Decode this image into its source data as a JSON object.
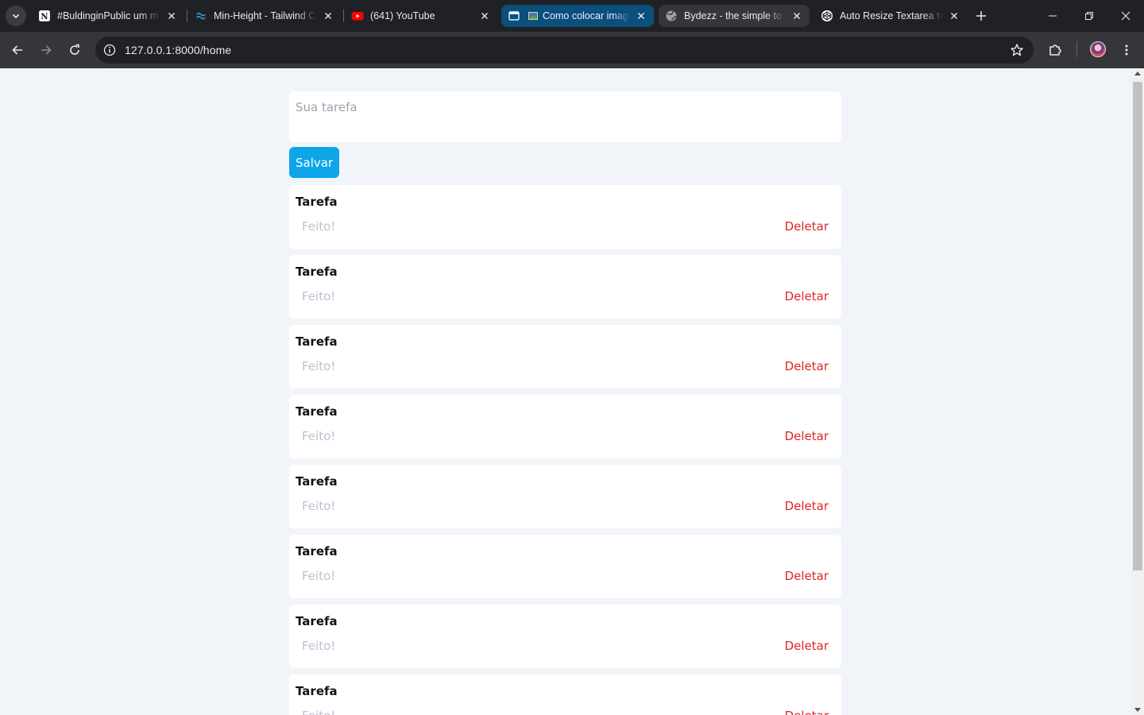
{
  "browser": {
    "tabs": [
      {
        "title": "#BuldinginPublic um m",
        "icon": "notion-icon"
      },
      {
        "title": "Min-Height - Tailwind C",
        "icon": "tailwind-icon"
      },
      {
        "title": "(641) YouTube",
        "icon": "youtube-icon"
      },
      {
        "title": "Como colocar imag",
        "icon": "image-icon",
        "group": true
      },
      {
        "title": "Bydezz - the simple to",
        "icon": "globe-icon",
        "active": true
      },
      {
        "title": "Auto Resize Textarea to",
        "icon": "codepen-icon"
      }
    ],
    "url": "127.0.0.1:8000/home",
    "accent_group_color": "#0b4f7c"
  },
  "form": {
    "placeholder": "Sua tarefa",
    "save_label": "Salvar"
  },
  "tasks": [
    {
      "title": "Tarefa",
      "done_label": "Feito!",
      "delete_label": "Deletar"
    },
    {
      "title": "Tarefa",
      "done_label": "Feito!",
      "delete_label": "Deletar"
    },
    {
      "title": "Tarefa",
      "done_label": "Feito!",
      "delete_label": "Deletar"
    },
    {
      "title": "Tarefa",
      "done_label": "Feito!",
      "delete_label": "Deletar"
    },
    {
      "title": "Tarefa",
      "done_label": "Feito!",
      "delete_label": "Deletar"
    },
    {
      "title": "Tarefa",
      "done_label": "Feito!",
      "delete_label": "Deletar"
    },
    {
      "title": "Tarefa",
      "done_label": "Feito!",
      "delete_label": "Deletar"
    },
    {
      "title": "Tarefa",
      "done_label": "Feito!",
      "delete_label": "Deletar"
    }
  ],
  "colors": {
    "page_bg": "#f1f5f9",
    "save_button": "#0ea5e9",
    "delete_text": "#dc2626",
    "done_text": "#b9c2cf"
  }
}
